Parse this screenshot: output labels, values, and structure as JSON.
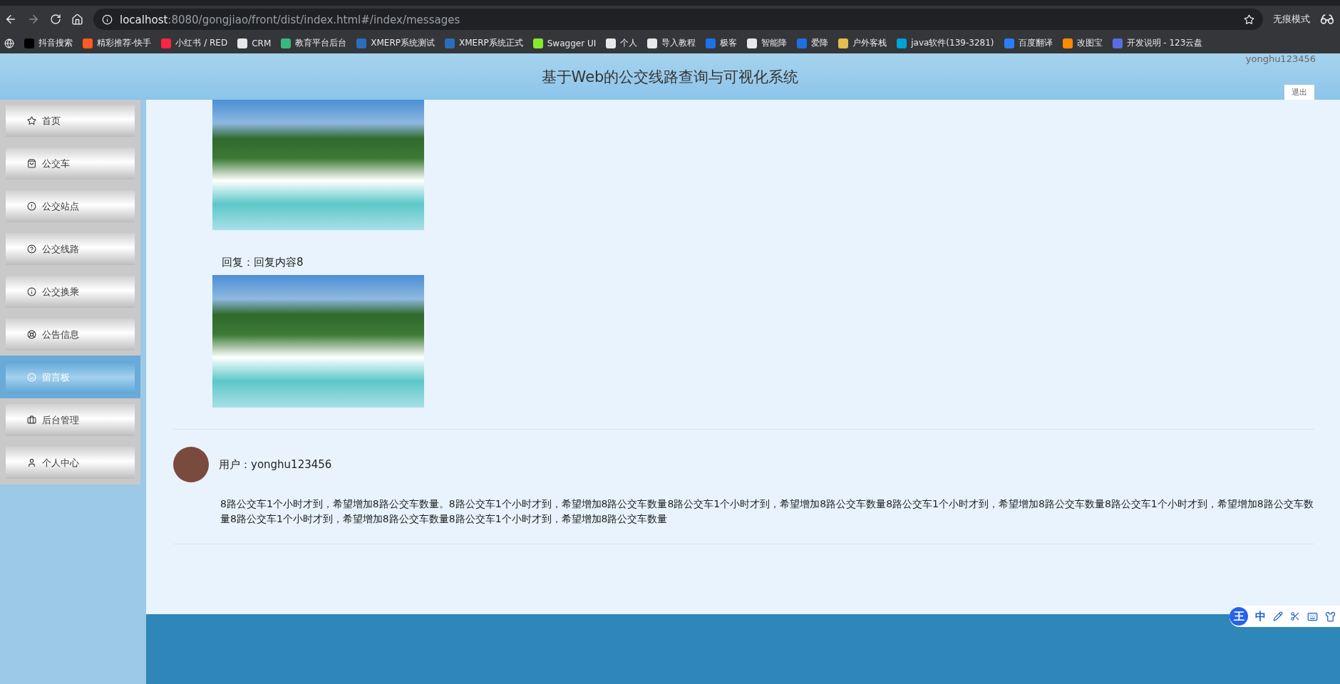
{
  "browser": {
    "url_host": "localhost",
    "url_path": ":8080/gongjiao/front/dist/index.html#/index/messages",
    "incognito_label": "无痕模式",
    "bookmarks": [
      {
        "label": "抖音搜索",
        "color": "#000000"
      },
      {
        "label": "精彩推荐-快手",
        "color": "#ff5a1f"
      },
      {
        "label": "小红书 / RED",
        "color": "#ff2442"
      },
      {
        "label": "CRM",
        "color": "#e8e8e8"
      },
      {
        "label": "教育平台后台",
        "color": "#3bb77e"
      },
      {
        "label": "XMERP系统测试",
        "color": "#2a6ebb"
      },
      {
        "label": "XMERP系统正式",
        "color": "#2a6ebb"
      },
      {
        "label": "Swagger UI",
        "color": "#85ea2d"
      },
      {
        "label": "个人",
        "color": "#e8e8e8"
      },
      {
        "label": "导入教程",
        "color": "#e8e8e8"
      },
      {
        "label": "极客",
        "color": "#1a73e8"
      },
      {
        "label": "智能降",
        "color": "#e8e8e8"
      },
      {
        "label": "爱降",
        "color": "#1e6fe0"
      },
      {
        "label": "户外客栈",
        "color": "#e0c050"
      },
      {
        "label": "java软件(139-3281)",
        "color": "#00a1d6"
      },
      {
        "label": "百度翻译",
        "color": "#2b7cf6"
      },
      {
        "label": "改图宝",
        "color": "#ff8a00"
      },
      {
        "label": "开发说明 - 123云盘",
        "color": "#5b6ee1"
      }
    ]
  },
  "header": {
    "title": "基于Web的公交线路查询与可视化系统",
    "username": "yonghu123456",
    "logout": "退出"
  },
  "sidebar": {
    "items": [
      {
        "label": "首页",
        "selected": false
      },
      {
        "label": "公交车",
        "selected": false
      },
      {
        "label": "公交站点",
        "selected": false
      },
      {
        "label": "公交线路",
        "selected": false
      },
      {
        "label": "公交换乘",
        "selected": false
      },
      {
        "label": "公告信息",
        "selected": false
      },
      {
        "label": "留言板",
        "selected": true
      },
      {
        "label": "后台管理",
        "selected": false
      },
      {
        "label": "个人中心",
        "selected": false
      }
    ]
  },
  "messages": [
    {
      "kind": "image_only"
    },
    {
      "kind": "reply",
      "reply": "回复：回复内容8"
    },
    {
      "kind": "post",
      "user": "用户：yonghu123456",
      "content": "8路公交车1个小时才到，希望增加8路公交车数量。8路公交车1个小时才到，希望增加8路公交车数量8路公交车1个小时才到，希望增加8路公交车数量8路公交车1个小时才到，希望增加8路公交车数量8路公交车1个小时才到，希望增加8路公交车数量8路公交车1个小时才到，希望增加8路公交车数量8路公交车1个小时才到，希望增加8路公交车数量"
    }
  ],
  "ime_toolbar": {
    "logo": "王",
    "mode": "中"
  }
}
